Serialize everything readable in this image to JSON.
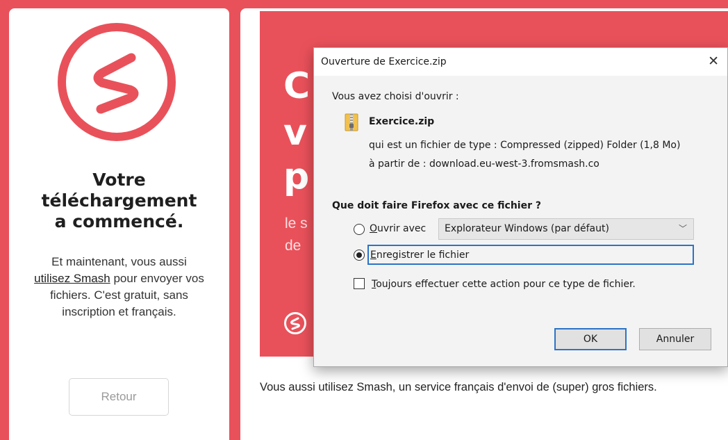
{
  "left_panel": {
    "title_lines": [
      "Votre",
      "téléchargement",
      "a commencé."
    ],
    "desc_before": "Et maintenant, vous aussi",
    "desc_link": "utilisez Smash",
    "desc_after": " pour envoyer vos fichiers. C'est gratuit, sans inscription et français.",
    "back_button": "Retour"
  },
  "promo": {
    "big_lines": [
      "C",
      "v",
      "p"
    ],
    "sub_lines": [
      "le s",
      "de "
    ],
    "footer_text": "Vous aussi utilisez Smash, un service français d'envoi de (super) gros fichiers."
  },
  "dialog": {
    "title": "Ouverture de Exercice.zip",
    "close_glyph": "✕",
    "chosen_label": "Vous avez choisi d'ouvrir :",
    "file_name": "Exercice.zip",
    "file_type": "qui est un fichier de type :  Compressed (zipped) Folder (1,8 Mo)",
    "file_source": "à partir de :  download.eu-west-3.fromsmash.co",
    "question": "Que doit faire Firefox avec ce fichier ?",
    "open_with_mnemonic": "O",
    "open_with_rest": "uvrir avec",
    "open_with_app": "Explorateur Windows (par défaut)",
    "save_mnemonic": "E",
    "save_rest": "nregistrer le fichier",
    "always_mnemonic": "T",
    "always_rest": "oujours effectuer cette action pour ce type de fichier.",
    "ok_button": "OK",
    "cancel_button": "Annuler",
    "selected_option": "save",
    "always_checked": false
  },
  "colors": {
    "brand": "#e9515a",
    "focus": "#2b73c6"
  },
  "icons": [
    "smash-logo-icon",
    "close-icon",
    "zip-file-icon",
    "chevron-down-icon"
  ]
}
